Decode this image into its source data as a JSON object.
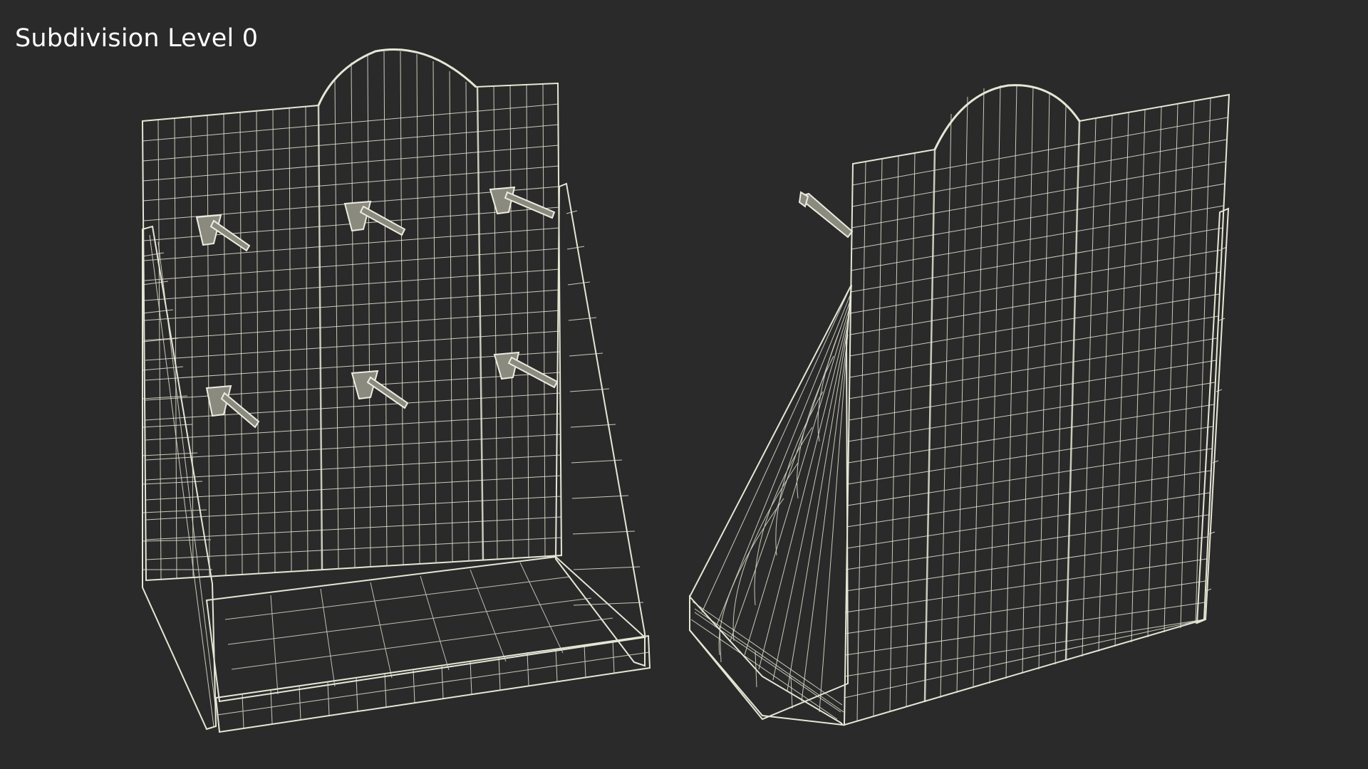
{
  "viewport_label": "Subdivision Level 0",
  "colors": {
    "background": "#2a2a2a",
    "mesh_fill_light": "#7e7e72",
    "mesh_fill_dark": "#4a4a44",
    "wire": "#e6e6d6"
  }
}
